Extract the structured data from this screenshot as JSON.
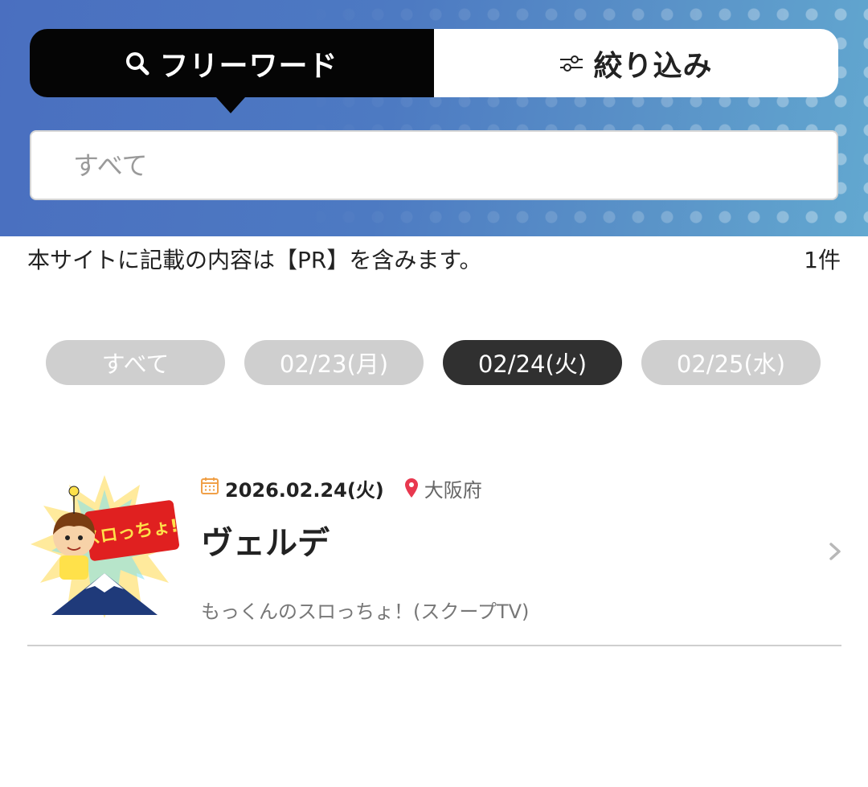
{
  "search": {
    "tabs": [
      {
        "label": "フリーワード",
        "icon": "search-icon",
        "active": true
      },
      {
        "label": "絞り込み",
        "icon": "sliders-icon",
        "active": false
      }
    ],
    "input_placeholder": "すべて",
    "input_value": ""
  },
  "notice": {
    "pr_text": "本サイトに記載の内容は【PR】を含みます。",
    "count": "1件"
  },
  "date_chips": [
    {
      "label": "すべて",
      "active": false
    },
    {
      "label": "02/23(月)",
      "active": false
    },
    {
      "label": "02/24(火)",
      "active": true
    },
    {
      "label": "02/25(水)",
      "active": false
    }
  ],
  "results": [
    {
      "date": "2026.02.24(火)",
      "prefecture": "大阪府",
      "title": "ヴェルデ",
      "subtitle": "もっくんのスロっちょ！(スクープTV)",
      "thumb_text": "スロっちょ!",
      "icons": {
        "date": "calendar-icon",
        "location": "map-pin-icon",
        "chevron": "chevron-right-icon"
      }
    }
  ],
  "colors": {
    "header_start": "#4a6fc0",
    "header_end": "#62a8d0",
    "active_tab": "#050505",
    "active_chip": "#303030",
    "inactive_chip": "#cfcfcf",
    "calendar_icon": "#f0a048",
    "pin_icon": "#e8384f"
  }
}
